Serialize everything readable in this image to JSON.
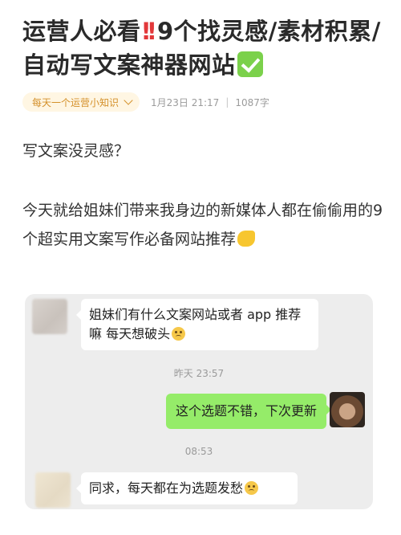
{
  "post": {
    "title_part1": "运营人必看",
    "title_bang": "‼️",
    "title_part2": "9个找灵感/素材积累/自动写文案神器网站",
    "title_check": "✅"
  },
  "meta": {
    "topic_chip": "每天一个运营小知识",
    "date": "1月23日 21:17",
    "divider": "|",
    "word_count": "1087字"
  },
  "body": {
    "paragraph1": "写文案没灵感？",
    "paragraph2": "今天就给姐妹们带来我身边的新媒体人都在偷偷用的9个超实用文案写作必备网站推荐",
    "flex_emoji": "💪"
  },
  "chat": {
    "message1": "姐妹们有什么文案网站或者 app 推荐嘛  每天想破头",
    "time1": "昨天  23:57",
    "message2": "这个选题不错，下次更新",
    "time2": "08:53",
    "message3": "同求，每天都在为选题发愁",
    "colors": {
      "sent_bubble": "#95ec69",
      "received_bubble": "#ffffff",
      "chat_background": "#ededed"
    }
  },
  "icons": {
    "chip_arrow": "chevron-down-icon",
    "emoji_sad": "sad-face-icon"
  },
  "colors": {
    "chip_text": "#d4902a",
    "chip_bg": "#fff6e3",
    "meta_text": "#9b9b9b"
  }
}
